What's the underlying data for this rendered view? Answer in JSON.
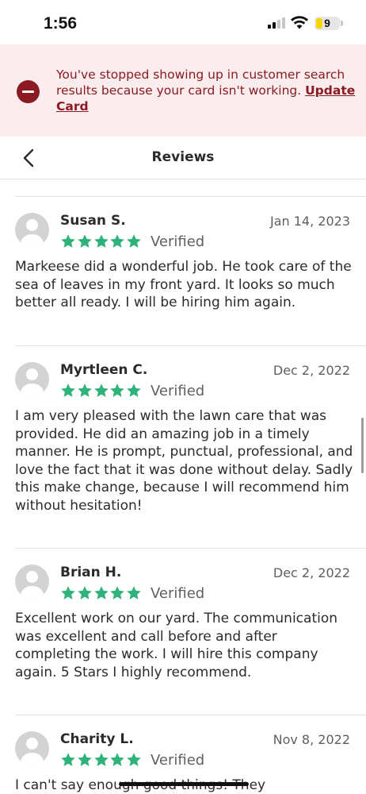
{
  "status_bar": {
    "time": "1:56",
    "battery": "9",
    "icons": [
      "signal-icon",
      "wifi-icon",
      "battery-icon"
    ]
  },
  "alert": {
    "icon": "no-entry-icon",
    "message": "You've stopped showing up in customer search results because your card isn't working.",
    "link_label": "Update Card",
    "color": "#8a1b22",
    "background": "#fbeced"
  },
  "nav": {
    "back_icon": "chevron-left-icon",
    "title": "Reviews"
  },
  "star_color": "#2fb37a",
  "reviews": [
    {
      "name": "Susan S.",
      "date": "Jan 14, 2023",
      "rating": 5,
      "verified": "Verified",
      "text": "Markeese did a wonderful job.  He took care of the sea of leaves in my front yard.  It looks so much better all ready. I will be hiring him again."
    },
    {
      "name": "Myrtleen C.",
      "date": "Dec 2, 2022",
      "rating": 5,
      "verified": "Verified",
      "text": "I am very pleased with the lawn care that was provided. He did an amazing job in a timely manner. He is prompt, punctual, professional, and love the fact that it was done without delay. Sadly this make change, because I will recommend him without hesitation!"
    },
    {
      "name": "Brian H.",
      "date": "Dec 2, 2022",
      "rating": 5,
      "verified": "Verified",
      "text": "Excellent work on our yard. The communication was excellent and call before and after completing the work. I will hire this company again. 5 Stars I highly recommend."
    },
    {
      "name": "Charity L.",
      "date": "Nov 8, 2022",
      "rating": 5,
      "verified": "Verified",
      "text": "I can't say enough good things! They"
    }
  ]
}
